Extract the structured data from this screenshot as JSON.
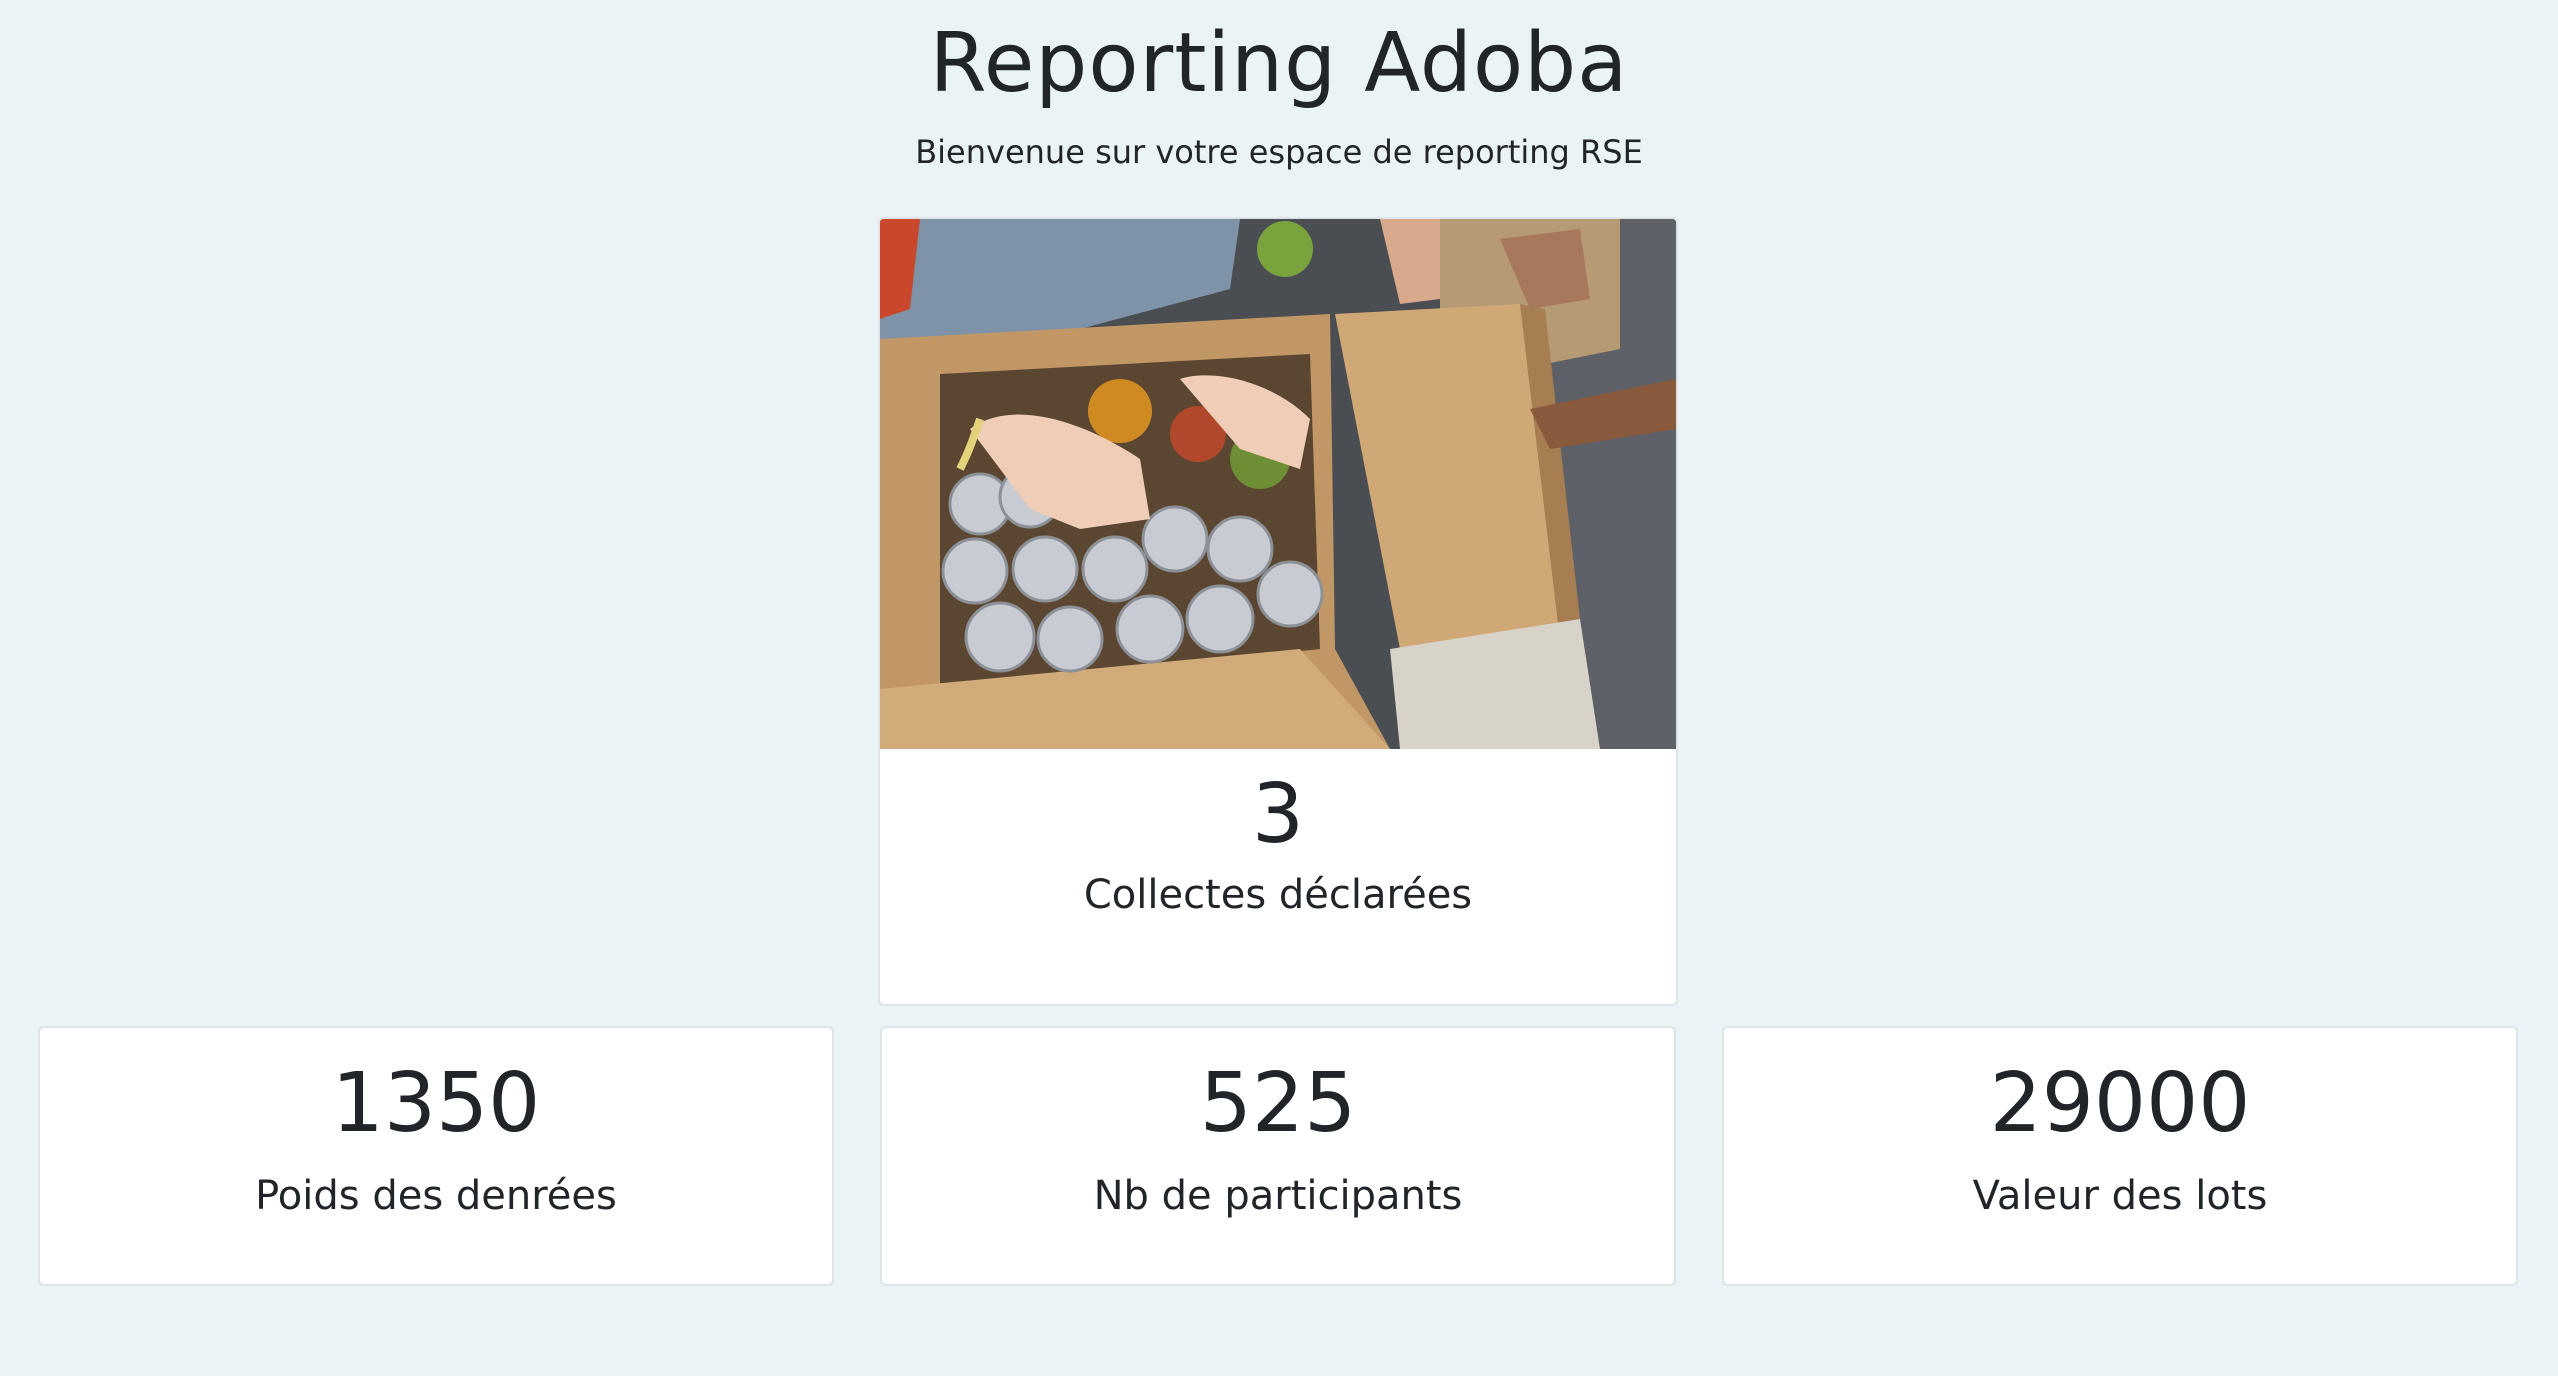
{
  "page": {
    "title": "Reporting Adoba",
    "subtitle": "Bienvenue sur votre espace de reporting RSE"
  },
  "featured_card": {
    "image_icon": "food-donation-photo",
    "value": "3",
    "label": "Collectes déclarées"
  },
  "stats": [
    {
      "value": "1350",
      "label": "Poids des denrées"
    },
    {
      "value": "525",
      "label": "Nb de participants"
    },
    {
      "value": "29000",
      "label": "Valeur des lots"
    }
  ],
  "colors": {
    "background": "#eaf4f6",
    "card": "#ffffff",
    "text": "#212529",
    "border": "#dde3e6"
  }
}
